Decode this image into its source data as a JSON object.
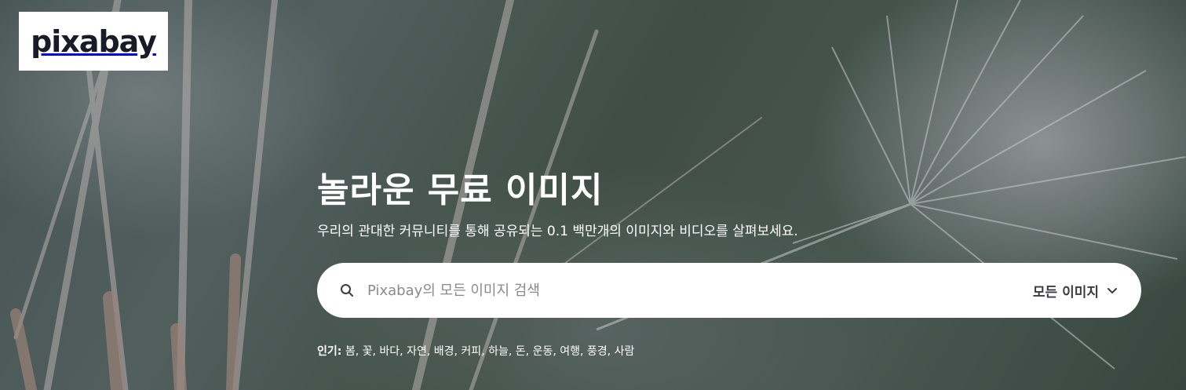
{
  "logo": {
    "text": "pixabay"
  },
  "hero": {
    "title": "놀라운 무료 이미지",
    "subtitle": "우리의 관대한 커뮤니티를 통해 공유되는 0.1 백만개의 이미지와 비디오를 살펴보세요."
  },
  "search": {
    "placeholder": "Pixabay의 모든 이미지 검색",
    "value": "",
    "type_label": "모든 이미지",
    "icon": "search-icon",
    "dropdown_icon": "chevron-down-icon"
  },
  "popular": {
    "label": "인기:",
    "tags": [
      "봄",
      "꽃",
      "바다",
      "자연",
      "배경",
      "커피",
      "하늘",
      "돈",
      "운동",
      "여행",
      "풍경",
      "사람"
    ]
  },
  "colors": {
    "logo_text": "#191b26",
    "overlay_text": "#ffffff",
    "search_bg": "#ffffff",
    "placeholder": "#8a8a8a"
  }
}
